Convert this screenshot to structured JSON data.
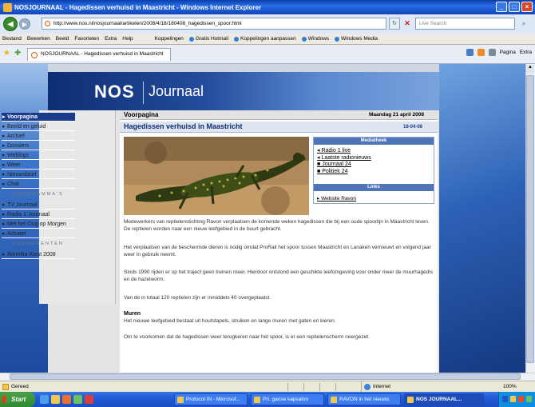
{
  "window": {
    "title": "NOSJOURNAAL - Hagedissen verhuisd in Maastricht - Windows Internet Explorer",
    "minimize": "_",
    "maximize": "□",
    "close": "×"
  },
  "address": {
    "url": "http://www.nos.nl/nosjournaal/artikelen/2008/4/18/180408_hagedissen_spoor.html",
    "go": "▼",
    "refresh": "↻",
    "stop": "✕",
    "search_placeholder": "Live Search",
    "back": "◀",
    "forward": "▶"
  },
  "menubar": {
    "items": [
      "Bestand",
      "Bewerken",
      "Beeld",
      "Favorieten",
      "Extra",
      "Help"
    ],
    "links": [
      "Koppelingen",
      "Gratis Hotmail",
      "Koppelingen aanpassen",
      "Windows",
      "Windows Media"
    ]
  },
  "tab": {
    "label": "NOSJOURNAAL - Hagedissen verhuisd in Maastricht"
  },
  "commandbar": {
    "page": "Pagina",
    "extra": "Extra"
  },
  "site": {
    "logo_nos": "NOS",
    "logo_journaal": "Journaal"
  },
  "sidebar": {
    "items": [
      "Voorpagina",
      "Beeld en geluid",
      "Archief",
      "Dossiers",
      "Weblogs",
      "Weer",
      "Nieuwsbrief",
      "Chat"
    ],
    "section_programmas": "PROGRAMMA'S",
    "programmas": [
      "TV Journaal",
      "Radio 1 Journaal",
      "Met het Oog op Morgen",
      "Actueel"
    ],
    "section_evenementen": "EVENEMENTEN",
    "evenementen": [
      "Amerika Kiest 2008"
    ]
  },
  "content": {
    "section_title": "Voorpagina",
    "date": "Maandag 21 april 2008",
    "article_title": "Hagedissen verhuisd in Maastricht",
    "article_code": "18-04-08",
    "paragraphs": [
      "Medewerkers van reptielenstichting Ravon verplaatsen de komende weken hagedissen die bij een oude spoorlijn in Maastricht leven. De reptielen worden naar een nieuw leefgebied in de buurt gebracht.",
      "Het verplaatsen van de beschermde dieren is nodig omdat ProRail het spoor tussen Maastricht en Lanaken vernieuwt en volgend jaar weer in gebruik neemt.",
      "Sinds 1990 rijden er op het traject geen treinen meer. Hierdoor ontstond een geschikte leefomgeving voor onder meer de muurhagedis en de hazelworm.",
      "Van de in totaal 120 reptielen zijn er inmiddels 40 overgeplaatst."
    ],
    "subhead": "Muren",
    "paragraphs2": [
      "Het nieuwe leefgebied bestaat uit houtstapels, struiken en lange muren met gaten en kieren.",
      "Om te voorkomen dat de hagedissen weer terugkeren naar het spoor, is er een reptielenscherm neergezet."
    ]
  },
  "mediatheek": {
    "title": "Mediatheek",
    "items": [
      "Radio 1 live",
      "Laatste radionieuws",
      "Journaal 24",
      "Politiek 24"
    ],
    "links_title": "Links",
    "link": "Website Ravon"
  },
  "status": {
    "text": "Gereed",
    "zone": "Internet",
    "zoom": "100%"
  },
  "taskbar": {
    "start": "Start",
    "items": [
      "Protocol IN - Microsof...",
      "Prl. ganse kapsalon",
      "RAVON in het nieuws",
      "NOS JOURNAAL..."
    ]
  }
}
